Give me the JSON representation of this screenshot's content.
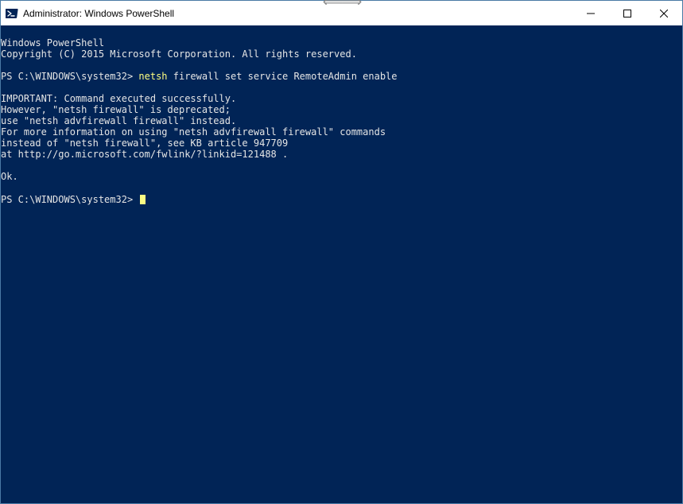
{
  "window": {
    "title": "Administrator: Windows PowerShell"
  },
  "terminal": {
    "banner1": "Windows PowerShell",
    "banner2": "Copyright (C) 2015 Microsoft Corporation. All rights reserved.",
    "blank": " ",
    "prompt1_prefix": "PS C:\\WINDOWS\\system32> ",
    "prompt1_cmd": "netsh",
    "prompt1_rest": " firewall set service RemoteAdmin enable",
    "out1": "IMPORTANT: Command executed successfully.",
    "out2": "However, \"netsh firewall\" is deprecated;",
    "out3": "use \"netsh advfirewall firewall\" instead.",
    "out4": "For more information on using \"netsh advfirewall firewall\" commands",
    "out5": "instead of \"netsh firewall\", see KB article 947709",
    "out6": "at http://go.microsoft.com/fwlink/?linkid=121488 .",
    "ok": "Ok.",
    "prompt2_prefix": "PS C:\\WINDOWS\\system32> "
  },
  "colors": {
    "terminal_bg": "#012456",
    "terminal_fg": "#e5e5e5",
    "cmd_fg": "#ffff80"
  }
}
